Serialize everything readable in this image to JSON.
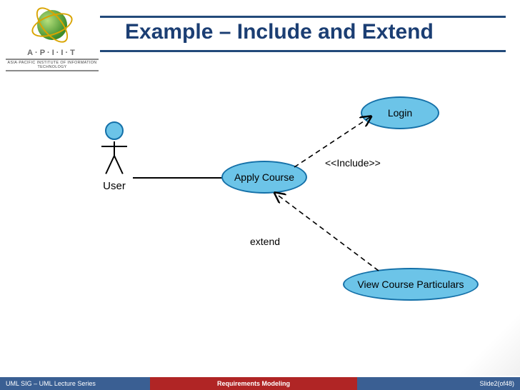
{
  "title": "Example – Include and Extend",
  "logo": {
    "letters": "A·P·I·I·T",
    "subtitle": "ASIA·PACIFIC INSTITUTE OF INFORMATION TECHNOLOGY"
  },
  "diagram": {
    "actor": {
      "label": "User"
    },
    "usecases": {
      "apply": "Apply Course",
      "login": "Login",
      "view": "View Course Particulars"
    },
    "relations": {
      "include_label": "<<Include>>",
      "extend_label": "extend"
    }
  },
  "footer": {
    "left": "UML SIG – UML Lecture Series",
    "center": "Requirements Modeling",
    "right_prefix": "Slide ",
    "slide_current": "2",
    "right_mid": " (of ",
    "slide_total": "48",
    "right_suffix": ")"
  }
}
